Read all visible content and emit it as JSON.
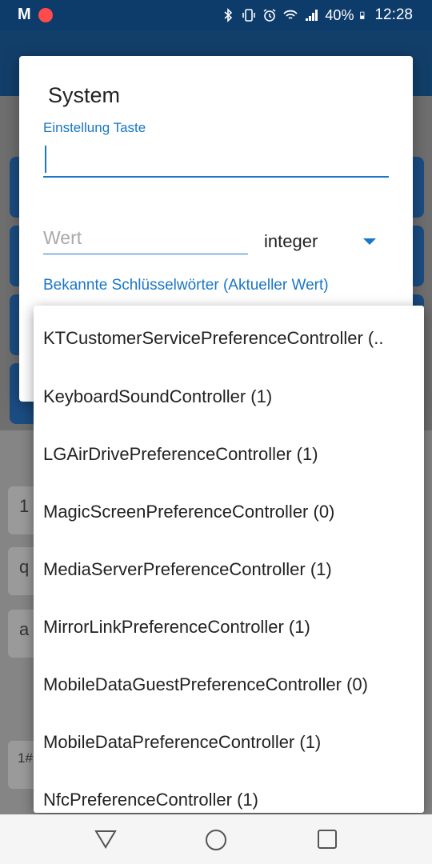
{
  "status_bar": {
    "logo": "M",
    "battery": "40%",
    "time": "12:28",
    "icons": [
      "bluetooth-icon",
      "vibrate-icon",
      "alarm-icon",
      "wifi-icon",
      "signal-icon",
      "battery-icon"
    ]
  },
  "dialog": {
    "title": "System",
    "key_label": "Einstellung Taste",
    "key_value": "",
    "value_placeholder": "Wert",
    "type_selected": "integer",
    "known_keys_label": "Bekannte Schlüsselwörter (Aktueller Wert)"
  },
  "dropdown": {
    "items": [
      "KTCustomerServicePreferenceController (..",
      "KeyboardSoundController (1)",
      "LGAirDrivePreferenceController (1)",
      "MagicScreenPreferenceController (0)",
      "MediaServerPreferenceController (1)",
      "MirrorLinkPreferenceController (1)",
      "MobileDataGuestPreferenceController (0)",
      "MobileDataPreferenceController (1)",
      "NfcPreferenceController (1)"
    ]
  },
  "keyboard_visible_keys": [
    "1",
    "q",
    "a",
    "1#"
  ],
  "colors": {
    "accent": "#1976c8",
    "status_bar": "#0d3c6b"
  }
}
